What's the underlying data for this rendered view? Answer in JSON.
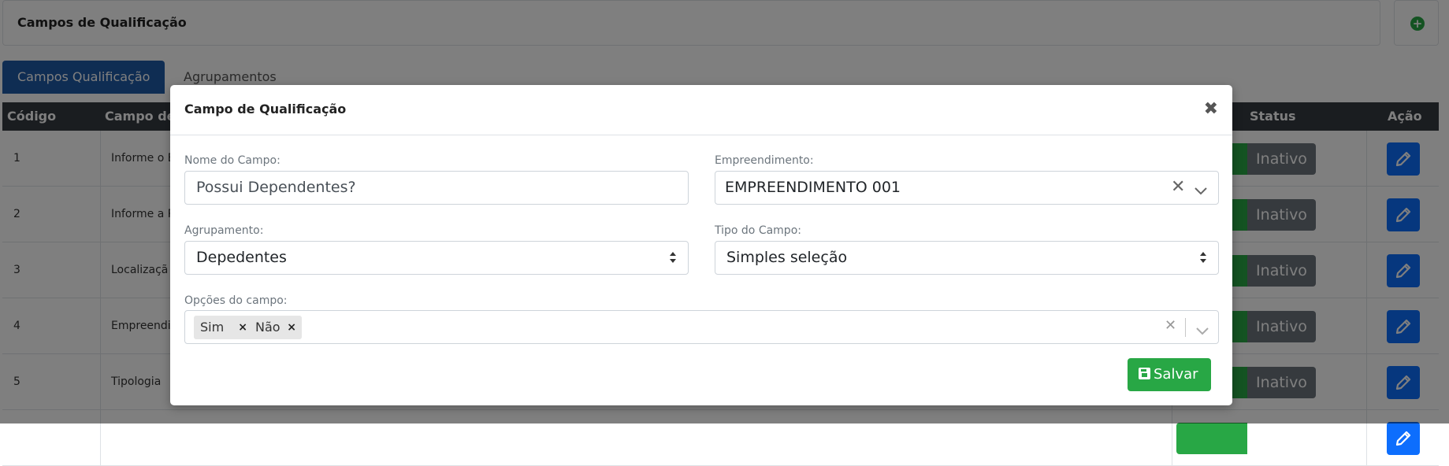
{
  "header": {
    "title": "Campos de Qualificação",
    "add_icon": "plus-circle-icon"
  },
  "tabs": [
    {
      "label": "Campos Qualificação",
      "active": true
    },
    {
      "label": "Agrupamentos",
      "active": false
    }
  ],
  "table": {
    "columns": [
      "Código",
      "Campo de",
      "Status",
      "Ação"
    ],
    "rows": [
      {
        "code": "1",
        "field": "Informe o E",
        "status": "Inativo"
      },
      {
        "code": "2",
        "field": "Informe a R",
        "status": "Inativo"
      },
      {
        "code": "3",
        "field": "Localizaçã",
        "status": "Inativo"
      },
      {
        "code": "4",
        "field": "Empreendi",
        "status": "Inativo"
      },
      {
        "code": "5",
        "field": "Tipologia",
        "status": "Inativo"
      }
    ]
  },
  "modal": {
    "title": "Campo de Qualificação",
    "close_symbol": "✖",
    "nome": {
      "label": "Nome do Campo:",
      "value": "Possui Dependentes?"
    },
    "empreendimento": {
      "label": "Empreendimento:",
      "value": "EMPREENDIMENTO 001",
      "clear_symbol": "✕"
    },
    "agrupamento": {
      "label": "Agrupamento:",
      "value": "Depedentes"
    },
    "tipo": {
      "label": "Tipo do Campo:",
      "value": "Simples seleção"
    },
    "opcoes": {
      "label": "Opções do campo:",
      "tags": [
        {
          "label": "Sim",
          "remove": "×"
        },
        {
          "label": "Não",
          "remove": "×"
        }
      ],
      "clear_symbol": "✕"
    },
    "save_label": "Salvar"
  },
  "colors": {
    "primary": "#1e5aa6",
    "success": "#28a745",
    "secondary": "#6c757d",
    "edit": "#0d6efd",
    "table_header": "#343a40"
  }
}
